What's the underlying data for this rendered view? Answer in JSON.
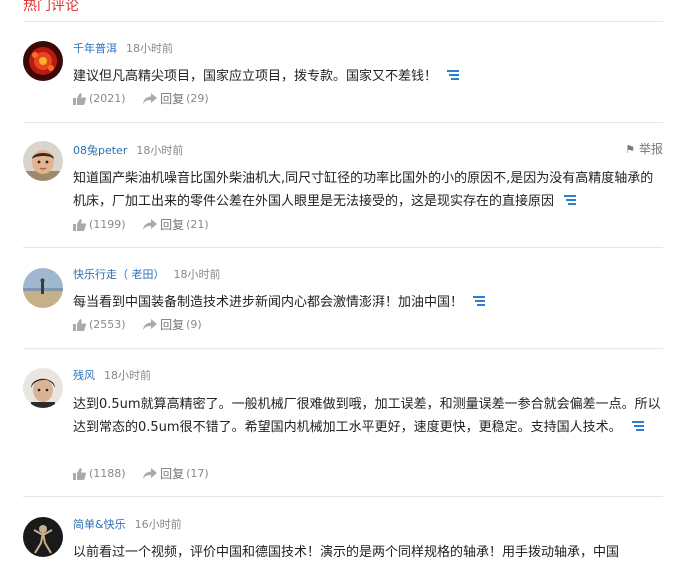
{
  "section_title": "热门评论",
  "comments": [
    {
      "user": "千年普洱",
      "time": "18小时前",
      "text": "建议但凡高精尖项目，国家应立项目，拨专款。国家又不差钱！",
      "likes": "(2021)",
      "reply_label": "回复",
      "replies": "(29)",
      "avatar_icon": "red-circle-avatar"
    },
    {
      "user": "08兔peter",
      "time": "18小时前",
      "report": "举报",
      "text": "知道国产柴油机噪音比国外柴油机大,同尺寸缸径的功率比国外的小的原因不,是因为没有高精度轴承的机床，厂加工出来的零件公差在外国人眼里是无法接受的，这是现实存在的直接原因",
      "likes": "(1199)",
      "reply_label": "回复",
      "replies": "(21)",
      "avatar_icon": "child-photo-avatar"
    },
    {
      "user": "快乐行走（ 老田）",
      "time": "18小时前",
      "text": "每当看到中国装备制造技术进步新闻内心都会激情澎湃！加油中国！",
      "likes": "(2553)",
      "reply_label": "回复",
      "replies": "(9)",
      "avatar_icon": "landscape-avatar"
    },
    {
      "user": "残风",
      "time": "18小时前",
      "text": "达到0.5um就算高精密了。一般机械厂很难做到哦，加工误差，和测量误差一参合就会偏差一点。所以达到常态的0.5um很不错了。希望国内机械加工水平更好，速度更快，更稳定。支持国人技术。",
      "likes": "(1188)",
      "reply_label": "回复",
      "replies": "(17)",
      "avatar_icon": "man-photo-avatar"
    },
    {
      "user": "简单&快乐",
      "time": "16小时前",
      "text": "以前看过一个视频，评价中国和德国技术！演示的是两个同样规格的轴承！用手拨动轴承，中国",
      "avatar_icon": "dancer-avatar"
    }
  ]
}
